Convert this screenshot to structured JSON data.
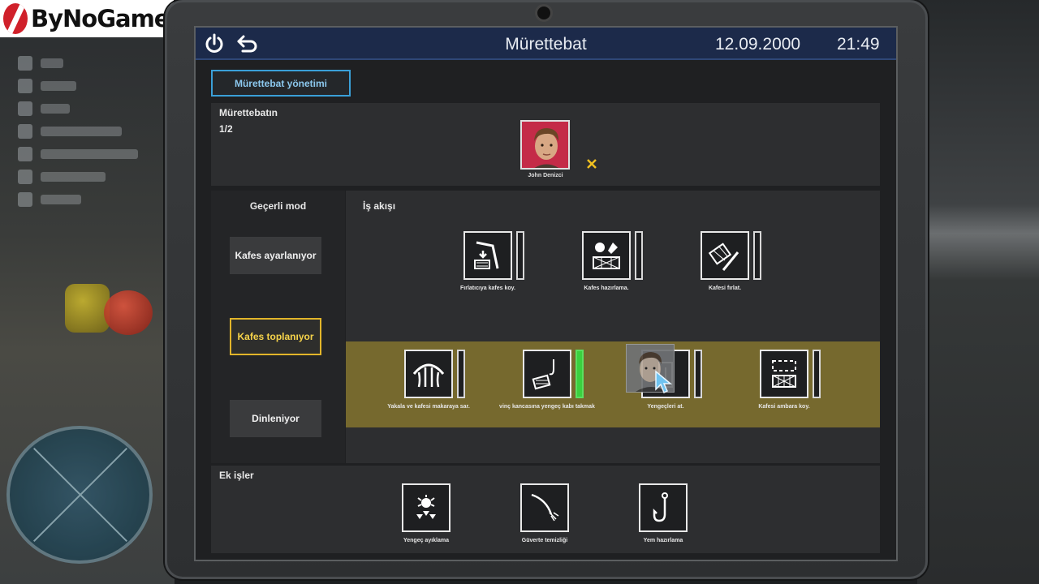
{
  "watermark": {
    "brand": "ByNoGame"
  },
  "header": {
    "title": "Mürettebat",
    "date": "12.09.2000",
    "time": "21:49"
  },
  "tabs": {
    "crew_management": "Mürettebat yönetimi"
  },
  "crew": {
    "title": "Mürettebatın",
    "count": "1/2",
    "members": [
      {
        "name": "John Denizci"
      }
    ]
  },
  "mode": {
    "title": "Geçerli mod",
    "options": [
      {
        "label": "Kafes ayarlanıyor",
        "active": false
      },
      {
        "label": "Kafes toplanıyor",
        "active": true
      },
      {
        "label": "Dinleniyor",
        "active": false
      }
    ]
  },
  "workflow": {
    "title": "İş akışı",
    "row1": [
      {
        "label": "Fırlatıcıya kafes koy.",
        "icon": "cage-launcher-icon"
      },
      {
        "label": "Kafes hazırlama.",
        "icon": "bait-cage-icon"
      },
      {
        "label": "Kafesi fırlat.",
        "icon": "throw-cage-icon"
      }
    ],
    "row2": [
      {
        "label": "Yakala ve kafesi makaraya sar.",
        "icon": "winch-grab-icon"
      },
      {
        "label": "vinç kancasına yengeç kabı takmak",
        "icon": "crane-hook-icon",
        "assigned": true
      },
      {
        "label": "Yengeçleri at.",
        "icon": "dump-crabs-icon"
      },
      {
        "label": "Kafesi ambara koy.",
        "icon": "store-cage-icon"
      }
    ]
  },
  "extras": {
    "title": "Ek işler",
    "items": [
      {
        "label": "Yengeç ayıklama",
        "icon": "crab-sort-icon"
      },
      {
        "label": "Güverte temizliği",
        "icon": "deck-hose-icon"
      },
      {
        "label": "Yem hazırlama",
        "icon": "fish-hook-icon"
      }
    ]
  },
  "colors": {
    "accent_blue": "#3aa0d8",
    "active_yellow": "#e2b52a",
    "highlight_row": "#76692e",
    "meter_green": "#3bd03f",
    "avatar_red": "#c42b48"
  }
}
